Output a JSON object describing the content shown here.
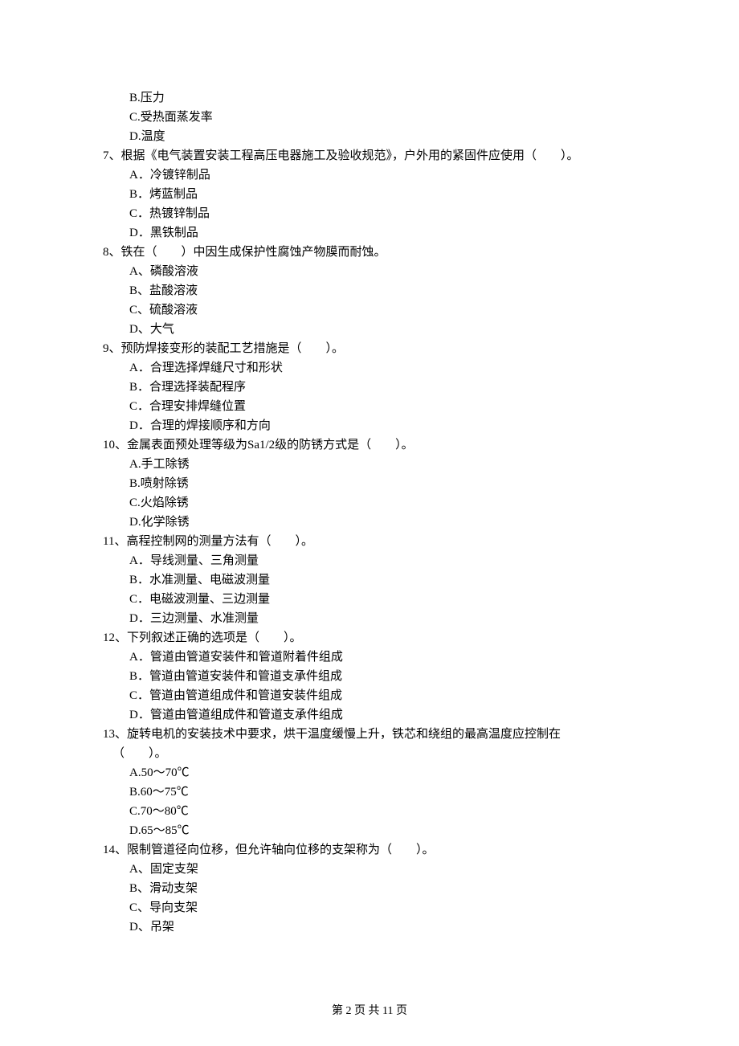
{
  "q6_opts": {
    "B": "B.压力",
    "C": "C.受热面蒸发率",
    "D": "D.温度"
  },
  "q7": {
    "stem": "7、根据《电气装置安装工程高压电器施工及验收规范》，户外用的紧固件应使用（　　）。",
    "A": "A．冷镀锌制品",
    "B": "B．烤蓝制品",
    "C": "C．热镀锌制品",
    "D": "D．黑铁制品"
  },
  "q8": {
    "stem": "8、铁在（　　）中因生成保护性腐蚀产物膜而耐蚀。",
    "A": "A、磷酸溶液",
    "B": "B、盐酸溶液",
    "C": "C、硫酸溶液",
    "D": "D、大气"
  },
  "q9": {
    "stem": "9、预防焊接变形的装配工艺措施是（　　）。",
    "A": "A．合理选择焊缝尺寸和形状",
    "B": "B．合理选择装配程序",
    "C": "C．合理安排焊缝位置",
    "D": "D．合理的焊接顺序和方向"
  },
  "q10": {
    "stem": "10、金属表面预处理等级为Sa1/2级的防锈方式是（　　）。",
    "A": "A.手工除锈",
    "B": "B.喷射除锈",
    "C": "C.火焰除锈",
    "D": "D.化学除锈"
  },
  "q11": {
    "stem": "11、高程控制网的测量方法有（　　）。",
    "A": "A．导线测量、三角测量",
    "B": "B．水准测量、电磁波测量",
    "C": "C．电磁波测量、三边测量",
    "D": "D．三边测量、水准测量"
  },
  "q12": {
    "stem": "12、下列叙述正确的选项是（　　）。",
    "A": "A．管道由管道安装件和管道附着件组成",
    "B": "B．管道由管道安装件和管道支承件组成",
    "C": "C．管道由管道组成件和管道安装件组成",
    "D": "D．管道由管道组成件和管道支承件组成"
  },
  "q13": {
    "stem_l1": "13、旋转电机的安装技术中要求，烘干温度缓慢上升，铁芯和绕组的最高温度应控制在",
    "stem_l2": "（　　）。",
    "A": "A.50～70℃",
    "B": "B.60～75℃",
    "C": "C.70～80℃",
    "D": "D.65～85℃"
  },
  "q14": {
    "stem": "14、限制管道径向位移，但允许轴向位移的支架称为（　　）。",
    "A": "A、固定支架",
    "B": "B、滑动支架",
    "C": "C、导向支架",
    "D": "D、吊架"
  },
  "footer": "第 2 页 共 11 页"
}
